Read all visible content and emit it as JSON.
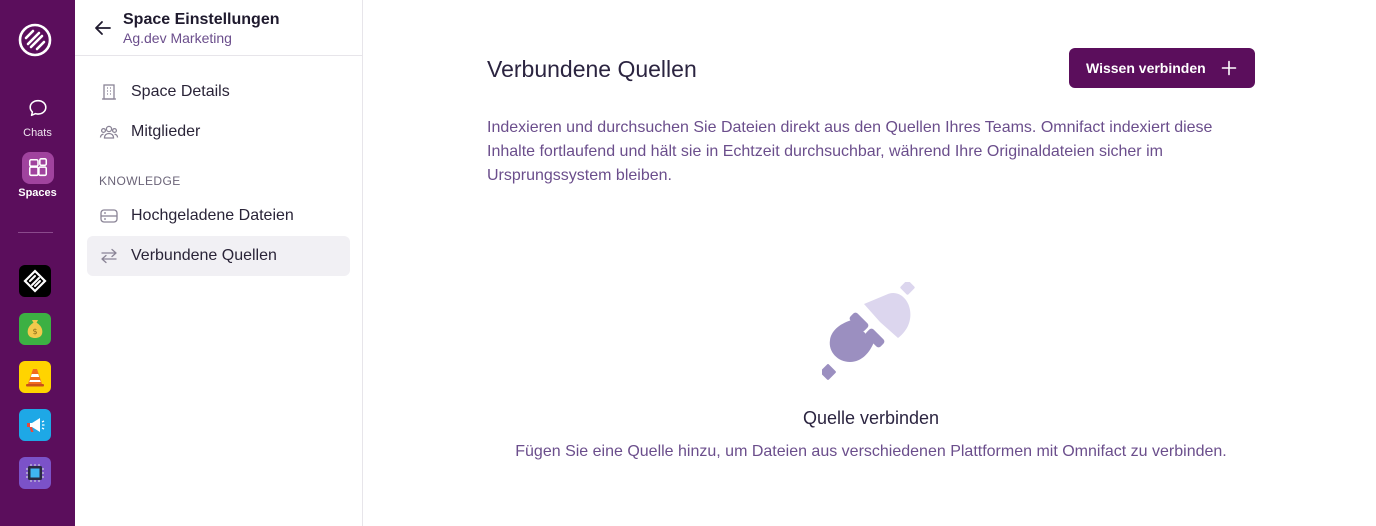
{
  "rail": {
    "chats_label": "Chats",
    "spaces_label": "Spaces",
    "spaces": [
      {
        "name": "ag-dev-space-icon",
        "bg": "#000000"
      },
      {
        "name": "money-bag-space-icon",
        "bg": "#3cb043"
      },
      {
        "name": "traffic-cone-space-icon",
        "bg": "#ffd400"
      },
      {
        "name": "megaphone-space-icon",
        "bg": "#1ea8e6"
      },
      {
        "name": "chip-space-icon",
        "bg": "#7b52c8"
      }
    ]
  },
  "sidebar": {
    "title": "Space Einstellungen",
    "subtitle": "Ag.dev Marketing",
    "items": [
      {
        "label": "Space Details",
        "icon": "building-icon"
      },
      {
        "label": "Mitglieder",
        "icon": "users-icon"
      }
    ],
    "section_label": "KNOWLEDGE",
    "knowledge_items": [
      {
        "label": "Hochgeladene Dateien",
        "icon": "database-icon"
      },
      {
        "label": "Verbundene Quellen",
        "icon": "arrows-exchange-icon",
        "active": true
      }
    ]
  },
  "main": {
    "title": "Verbundene Quellen",
    "connect_button": "Wissen verbinden",
    "description": "Indexieren und durchsuchen Sie Dateien direkt aus den Quellen Ihres Teams. Omnifact indexiert diese Inhalte fortlaufend und hält sie in Echtzeit durchsuchbar, während Ihre Originaldateien sicher im Ursprungssystem bleiben.",
    "empty_title": "Quelle verbinden",
    "empty_subtitle": "Fügen Sie eine Quelle hinzu, um Dateien aus verschiedenen Plattformen mit Omnifact zu verbinden."
  },
  "colors": {
    "brand": "#5b0e5c",
    "accent_text": "#6b4e8c",
    "plug_dark": "#9b8fc0",
    "plug_light": "#dcd6ee"
  }
}
